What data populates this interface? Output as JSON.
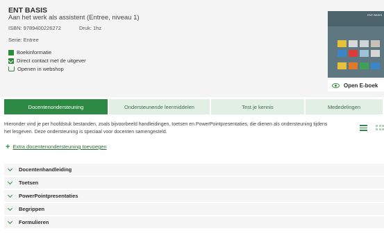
{
  "book": {
    "title": "ENT BASIS",
    "subtitle": "Aan het werk als assistent (Entree, niveau 1)",
    "isbn": "ISBN: 9789400226272",
    "druk": "Druk: 1hz",
    "serie": "Serie: Entree"
  },
  "links": [
    {
      "label": "Boekinformatie",
      "icon": "info-icon"
    },
    {
      "label": "Direct contact met de uitgever",
      "icon": "mail-icon"
    },
    {
      "label": "Openen in webshop",
      "icon": "cart-icon"
    }
  ],
  "cover": {
    "label": "ENT BASIS"
  },
  "ebook": {
    "label": "Open E-boek"
  },
  "tabs": [
    {
      "label": "Docentenondersteuning",
      "active": true
    },
    {
      "label": "Ondersteunende leermiddelen",
      "active": false
    },
    {
      "label": "Test je kennis",
      "active": false
    },
    {
      "label": "Mededelingen",
      "active": false
    }
  ],
  "description": "Hieronder vind je per hoofdstuk bestanden, zoals bijvoorbeeld handleidingen, toetsen en PowerPointpresentaties, die dienen als ondersteuning tijdens het lesgeven. Deze ondersteuning is speciaal voor docenten samengesteld.",
  "add_link": {
    "label": "Extra docentenondersteuning toevoegen"
  },
  "sections": [
    {
      "label": "Docentenhandleiding"
    },
    {
      "label": "Toetsen"
    },
    {
      "label": "PowerPointpresentaties"
    },
    {
      "label": "Begrippen"
    },
    {
      "label": "Formulieren"
    }
  ],
  "colors": {
    "accent": "#2c8a44",
    "tab_inactive": "#e2efe5",
    "header_bg": "#f4f4f4"
  }
}
